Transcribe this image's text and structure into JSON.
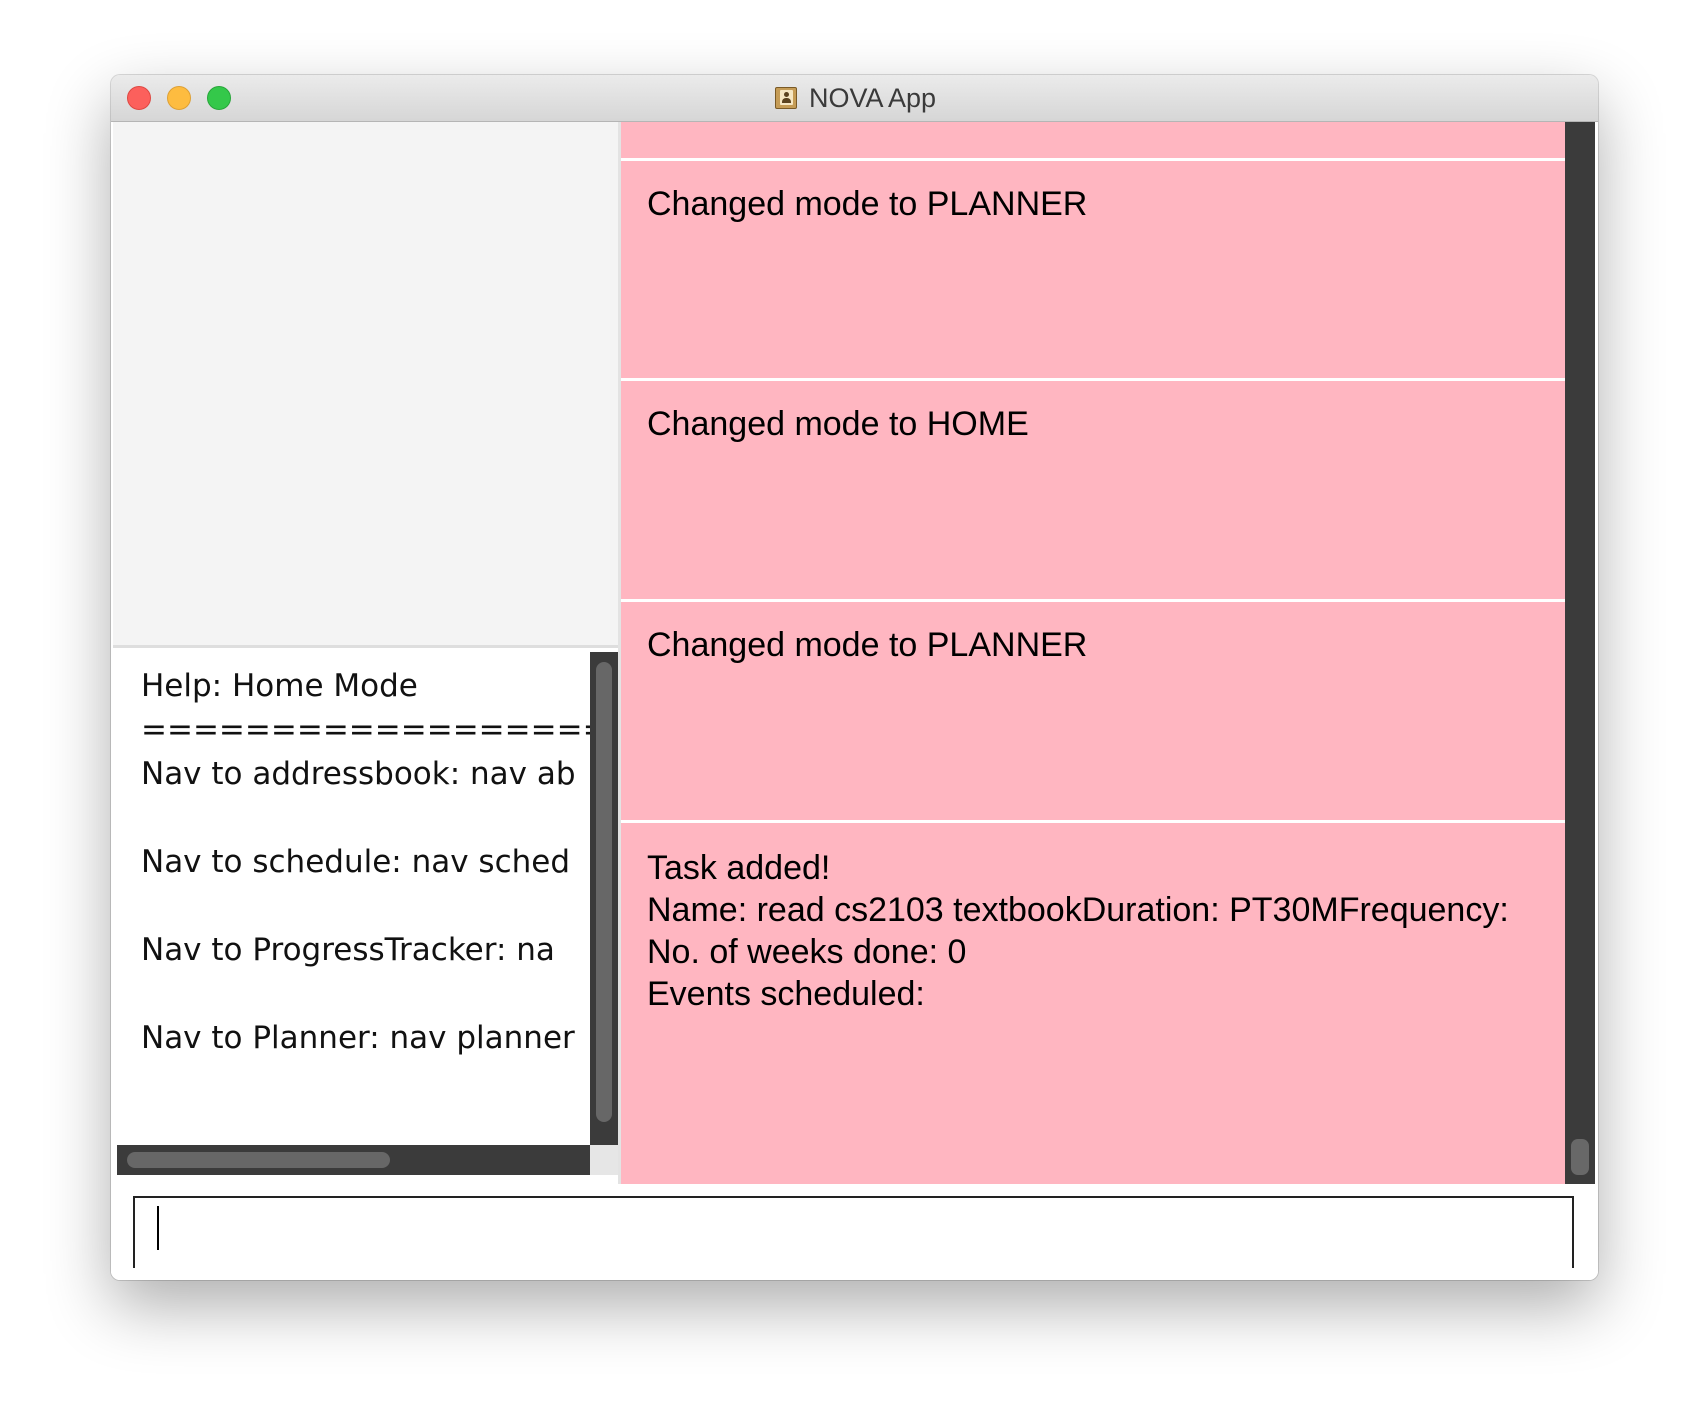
{
  "window": {
    "title": "NOVA App",
    "app_icon": "address-book-icon",
    "controls": [
      "close",
      "minimize",
      "maximize"
    ]
  },
  "help_panel": {
    "text": "Help: Home Mode\n===================\nNav to addressbook: nav ab\n\nNav to schedule: nav sched\n\nNav to ProgressTracker: na\n\nNav to Planner: nav planner"
  },
  "result_cards": [
    {
      "text": ""
    },
    {
      "text": "Changed mode to PLANNER"
    },
    {
      "text": "Changed mode to HOME"
    },
    {
      "text": "Changed mode to PLANNER"
    },
    {
      "text": "Task added!\nName: read cs2103 textbookDuration: PT30MFrequency:\nNo. of weeks done: 0\nEvents scheduled:"
    }
  ],
  "command_input": {
    "value": "",
    "placeholder": ""
  },
  "colors": {
    "card_background": "#ffb6c1",
    "scrollbar_track": "#3b3b3b",
    "scrollbar_thumb": "#676767",
    "left_panel_background": "#f4f4f4"
  }
}
